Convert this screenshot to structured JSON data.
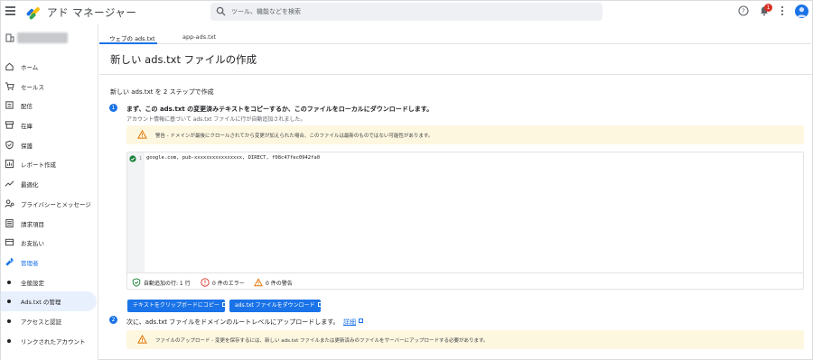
{
  "app": {
    "title": "アド マネージャー"
  },
  "search": {
    "placeholder": "ツール、機能などを検索"
  },
  "header": {
    "notification_count": "1"
  },
  "sidebar": {
    "items": [
      {
        "label": "ホーム",
        "icon": "home-icon"
      },
      {
        "label": "セールス",
        "icon": "cart-icon"
      },
      {
        "label": "配信",
        "icon": "delivery-icon"
      },
      {
        "label": "在庫",
        "icon": "inventory-icon"
      },
      {
        "label": "保護",
        "icon": "shield-icon"
      },
      {
        "label": "レポート作成",
        "icon": "report-icon"
      },
      {
        "label": "最適化",
        "icon": "trend-icon"
      },
      {
        "label": "プライバシーとメッセージ",
        "icon": "privacy-icon"
      },
      {
        "label": "請求項目",
        "icon": "billing-icon"
      },
      {
        "label": "お支払い",
        "icon": "payment-icon"
      },
      {
        "label": "管理者",
        "icon": "wrench-icon"
      },
      {
        "label": "全般設定"
      },
      {
        "label": "Ads.txt の管理"
      },
      {
        "label": "アクセスと認証"
      },
      {
        "label": "リンクされたアカウント"
      }
    ]
  },
  "tabs": [
    {
      "label": "ウェブの ads.txt"
    },
    {
      "label": "app-ads.txt"
    }
  ],
  "main": {
    "title": "新しい ads.txt ファイルの作成",
    "intro": "新しい ads.txt を 2 ステップで作成",
    "step1": {
      "number": "1",
      "title": "まず、この ads.txt の変更済みテキストをコピーするか、このファイルをローカルにダウンロードします。",
      "subtitle": "アカウント情報に基づいて ads.txt ファイルに行が自動追加されました。",
      "warning": "警告 - ドメインが最後にクロールされてから変更が加えられた場合、このファイルは最新のものではない可能性があります。"
    },
    "editor": {
      "line_number": "1",
      "code": "google.com, pub-xxxxxxxxxxxxxxxx, DIRECT, f08c47fec0942fa0",
      "stat_added": "自動追加の行: 1 行",
      "stat_errors": "0 件のエラー",
      "stat_warnings": "0 件の警告"
    },
    "buttons": {
      "copy": "テキストをクリップボードにコピー",
      "download": "ads.txt ファイルをダウンロード"
    },
    "step2": {
      "number": "2",
      "title": "次に、ads.txt ファイルをドメインのルートレベルにアップロードします。",
      "link": "詳細",
      "warning": "ファイルのアップロード - 変更を保存するには、新しい ads.txt ファイルまたは更新済みのファイルをサーバーにアップロードする必要があります。"
    }
  },
  "colors": {
    "accent": "#1a73e8",
    "warning_bg": "#fef7e0",
    "warning_icon": "#e37400",
    "error": "#d93025",
    "success": "#188038"
  }
}
